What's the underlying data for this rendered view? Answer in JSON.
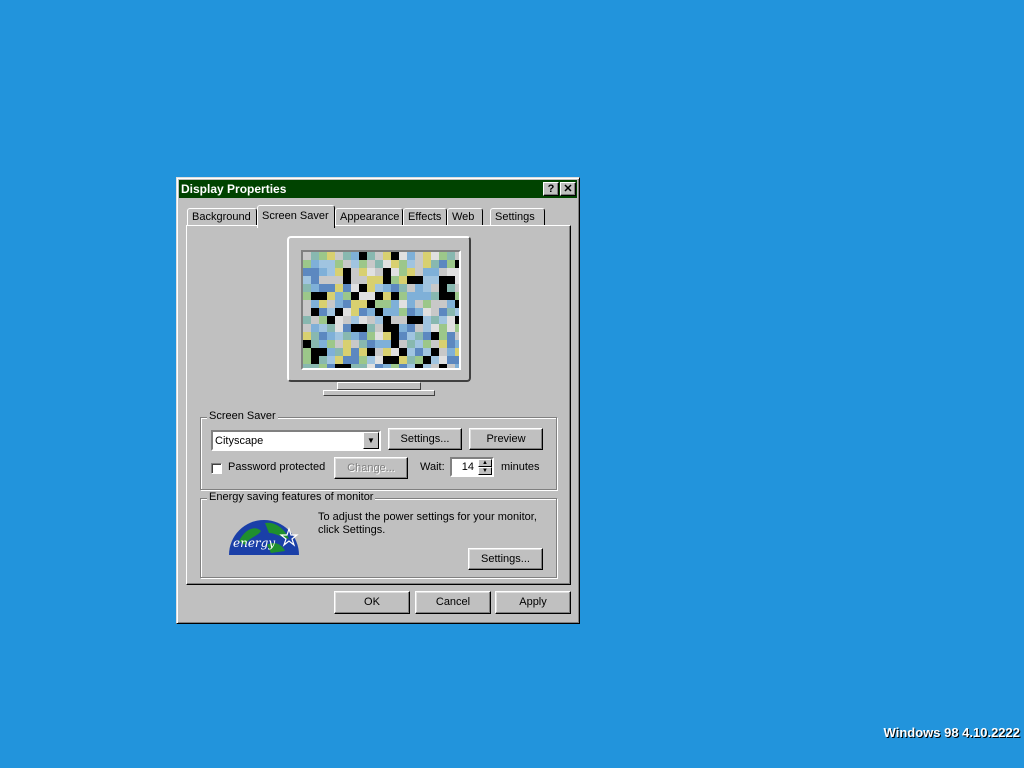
{
  "window": {
    "title": "Display Properties",
    "help_label": "?",
    "close_label": "✕"
  },
  "tabs": [
    {
      "label": "Background",
      "active": false
    },
    {
      "label": "Screen Saver",
      "active": true
    },
    {
      "label": "Appearance",
      "active": false
    },
    {
      "label": "Effects",
      "active": false
    },
    {
      "label": "Web",
      "active": false
    },
    {
      "label": "Settings",
      "active": false
    }
  ],
  "screen_saver": {
    "group_label": "Screen Saver",
    "selected": "Cityscape",
    "settings_button": "Settings...",
    "preview_button": "Preview",
    "password_label": "Password protected",
    "password_checked": false,
    "change_button": "Change...",
    "wait_label": "Wait:",
    "wait_value": "14",
    "minutes_label": "minutes"
  },
  "energy": {
    "group_label": "Energy saving features of monitor",
    "description": "To adjust the power settings for your monitor, click Settings.",
    "settings_button": "Settings...",
    "logo_text": "energy"
  },
  "buttons": {
    "ok": "OK",
    "cancel": "Cancel",
    "apply": "Apply"
  },
  "desktop": {
    "version_text": "Windows 98 4.10.2222"
  },
  "colors": {
    "desktop": "#2294dc",
    "titlebar": "#004300",
    "face": "#c0c0c0"
  }
}
